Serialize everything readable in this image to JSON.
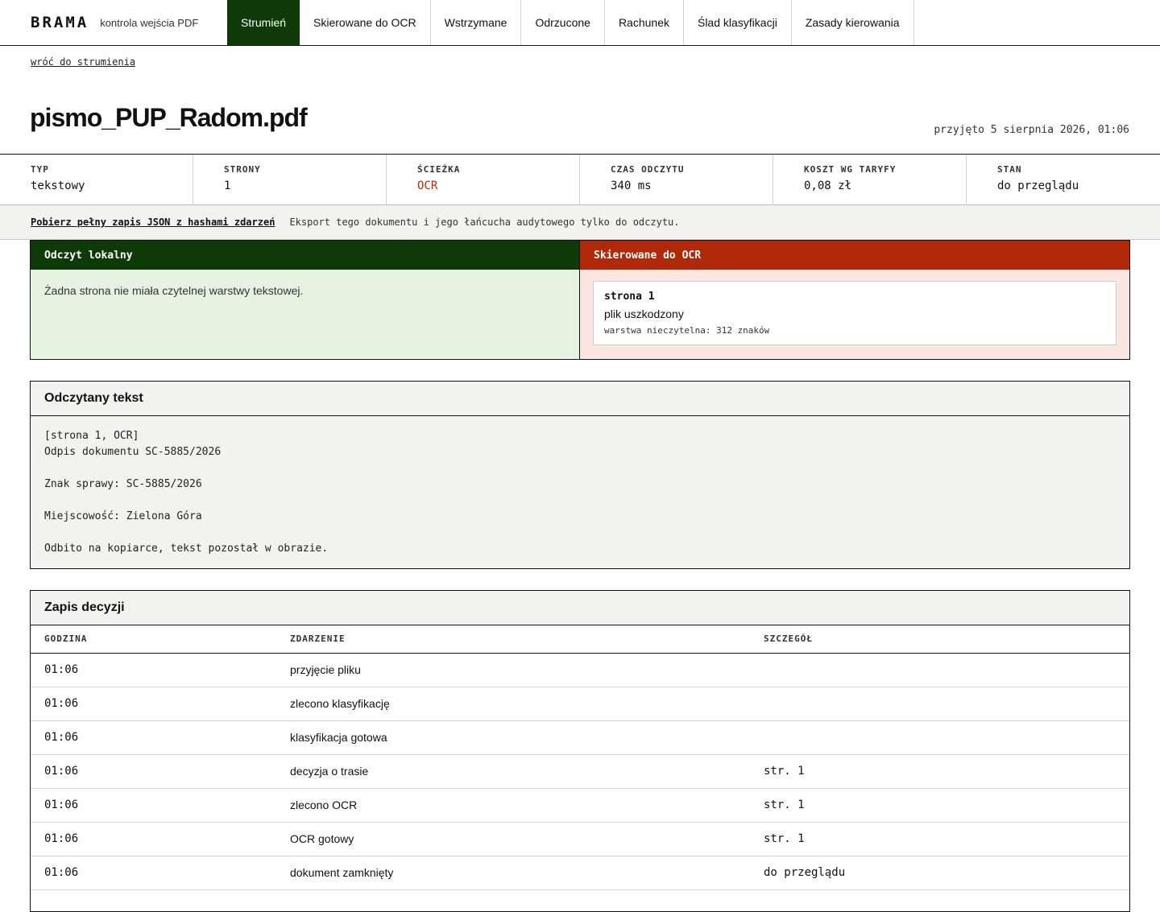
{
  "app": {
    "brand": "BRAMA",
    "subtitle": "kontrola wejścia PDF"
  },
  "nav": {
    "tabs": [
      {
        "label": "Strumień",
        "active": true
      },
      {
        "label": "Skierowane do OCR",
        "active": false
      },
      {
        "label": "Wstrzymane",
        "active": false
      },
      {
        "label": "Odrzucone",
        "active": false
      },
      {
        "label": "Rachunek",
        "active": false
      },
      {
        "label": "Ślad klasyfikacji",
        "active": false
      },
      {
        "label": "Zasady kierowania",
        "active": false
      }
    ]
  },
  "back_link": "wróć do strumienia",
  "document": {
    "title": "pismo_PUP_Radom.pdf",
    "received": "przyjęto 5 sierpnia 2026, 01:06"
  },
  "meta": [
    {
      "label": "TYP",
      "value": "tekstowy"
    },
    {
      "label": "STRONY",
      "value": "1"
    },
    {
      "label": "ŚCIEŻKA",
      "value": "OCR"
    },
    {
      "label": "CZAS ODCZYTU",
      "value": "340 ms"
    },
    {
      "label": "KOSZT WG TARYFY",
      "value": "0,08 zł"
    },
    {
      "label": "STAN",
      "value": "do przeglądu"
    }
  ],
  "export": {
    "link": "Pobierz pełny zapis JSON z hashami zdarzeń",
    "note": "Eksport tego dokumentu i jego łańcucha audytowego tylko do odczytu."
  },
  "local": {
    "title": "Odczyt lokalny",
    "message": "Żadna strona nie miała czytelnej warstwy tekstowej."
  },
  "ocr": {
    "title": "Skierowane do OCR",
    "pages": [
      {
        "page": "strona 1",
        "reason": "plik uszkodzony",
        "detail": "warstwa nieczytelna: 312 znaków"
      }
    ]
  },
  "text": {
    "title": "Odczytany tekst",
    "lines": [
      "[strona 1, OCR]",
      "Odpis dokumentu SC-5885/2026",
      "",
      "Znak sprawy: SC-5885/2026",
      "",
      "Miejscowość: Zielona Góra",
      "",
      "Odbito na kopiarce, tekst pozostał w obrazie."
    ]
  },
  "decisions": {
    "title": "Zapis decyzji",
    "columns": [
      "GODZINA",
      "ZDARZENIE",
      "SZCZEGÓŁ"
    ],
    "rows": [
      {
        "time": "01:06",
        "event": "przyjęcie pliku",
        "detail": ""
      },
      {
        "time": "01:06",
        "event": "zlecono klasyfikację",
        "detail": ""
      },
      {
        "time": "01:06",
        "event": "klasyfikacja gotowa",
        "detail": ""
      },
      {
        "time": "01:06",
        "event": "decyzja o trasie",
        "detail": "str. 1"
      },
      {
        "time": "01:06",
        "event": "zlecono OCR",
        "detail": "str. 1"
      },
      {
        "time": "01:06",
        "event": "OCR gotowy",
        "detail": "str. 1"
      },
      {
        "time": "01:06",
        "event": "dokument zamknięty",
        "detail": "do przeglądu"
      }
    ]
  },
  "colors": {
    "accent_green": "#0e3a08",
    "accent_red": "#b02a0a",
    "panel_green": "#e5f4e1",
    "panel_red": "#fbe7e1",
    "muted_bg": "#f2f3f0"
  }
}
